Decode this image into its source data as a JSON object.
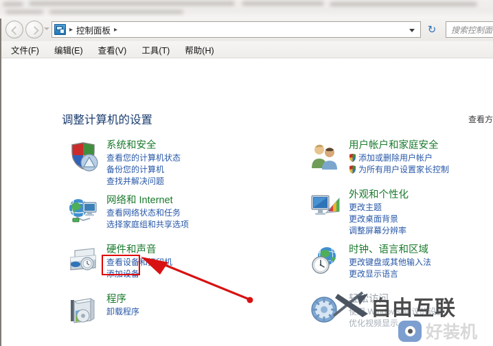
{
  "window": {
    "address": {
      "icon": "control-panel-icon",
      "crumbs": [
        "控制面板"
      ],
      "separator": "▸",
      "dropdown_icon": "chevron-down-icon",
      "refresh_icon": "↻"
    },
    "search": {
      "placeholder": "搜索控制面板",
      "value": "搜索控制面"
    },
    "nav": {
      "back_icon": "back-arrow-icon",
      "forward_icon": "forward-arrow-icon",
      "history_icon": "chevron-down-icon"
    },
    "menubar": [
      {
        "label": "文件(F)"
      },
      {
        "label": "编辑(E)"
      },
      {
        "label": "查看(V)"
      },
      {
        "label": "工具(T)"
      },
      {
        "label": "帮助(H)"
      }
    ]
  },
  "main": {
    "heading": "调整计算机的设置",
    "view_by": "查看方",
    "left_categories": [
      {
        "icon": "shield-icon",
        "title": "系统和安全",
        "links": [
          {
            "label": "查看您的计算机状态"
          },
          {
            "label": "备份您的计算机"
          },
          {
            "label": "查找并解决问题"
          }
        ]
      },
      {
        "icon": "network-globe-icon",
        "title": "网络和 Internet",
        "links": [
          {
            "label": "查看网络状态和任务"
          },
          {
            "label": "选择家庭组和共享选项"
          }
        ]
      },
      {
        "icon": "printer-icon",
        "title": "硬件和声音",
        "links": [
          {
            "label": "查看设备和打印机"
          },
          {
            "label": "添加设备"
          }
        ]
      },
      {
        "icon": "programs-box-icon",
        "title": "程序",
        "links": [
          {
            "label": "卸载程序"
          }
        ]
      }
    ],
    "right_categories": [
      {
        "icon": "user-accounts-icon",
        "title": "用户帐户和家庭安全",
        "links": [
          {
            "label": "添加或删除用户帐户",
            "uac": true
          },
          {
            "label": "为所有用户设置家长控制",
            "uac": true
          }
        ]
      },
      {
        "icon": "appearance-monitor-icon",
        "title": "外观和个性化",
        "links": [
          {
            "label": "更改主题"
          },
          {
            "label": "更改桌面背景"
          },
          {
            "label": "调整屏幕分辨率"
          }
        ]
      },
      {
        "icon": "clock-globe-icon",
        "title": "时钟、语言和区域",
        "links": [
          {
            "label": "更改键盘或其他输入法"
          },
          {
            "label": "更改显示语言"
          }
        ]
      },
      {
        "icon": "ease-of-access-icon",
        "title": "轻松访问",
        "dim": true,
        "links": [
          {
            "label": "使用 Windows 建议的设置",
            "dim": true
          },
          {
            "label": "优化视频显示",
            "dim": true
          }
        ]
      }
    ]
  },
  "annotation": {
    "highlight_target": "程序",
    "box_color": "#e00000",
    "arrow_color": "#d81212",
    "arrow_icon": "red-arrow-icon"
  },
  "watermarks": {
    "primary": {
      "text": "自由互联",
      "logo": "x-logo-icon",
      "color": "#4b4b4b"
    },
    "secondary": {
      "text": "好装机",
      "logo": "eye-logo-icon",
      "color": "#d8d8d8"
    }
  }
}
